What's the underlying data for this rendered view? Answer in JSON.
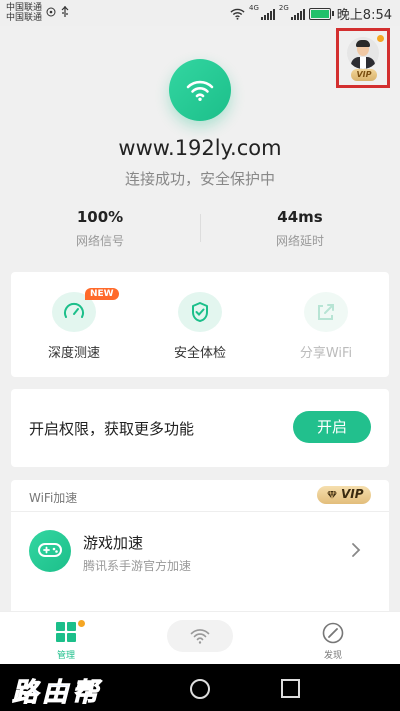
{
  "status_bar": {
    "carrier1": "中国联通",
    "carrier2": "中国联通",
    "net1": "4G",
    "net2": "2G",
    "time": "晚上8:54"
  },
  "profile": {
    "vip_label": "VIP"
  },
  "connection": {
    "ssid": "www.192ly.com",
    "status": "连接成功，安全保护中",
    "signal_value": "100%",
    "signal_label": "网络信号",
    "latency_value": "44ms",
    "latency_label": "网络延时"
  },
  "tools": [
    {
      "label": "深度测速",
      "badge": "NEW",
      "icon": "speedometer-icon"
    },
    {
      "label": "安全体检",
      "icon": "shield-check-icon"
    },
    {
      "label": "分享WiFi",
      "icon": "share-icon",
      "disabled": true
    }
  ],
  "permission": {
    "text": "开启权限，获取更多功能",
    "button": "开启"
  },
  "wifi_accel": {
    "section_title": "WiFi加速",
    "vip_label": "VIP",
    "item_title": "游戏加速",
    "item_subtitle": "腾讯系手游官方加速"
  },
  "tabbar": {
    "tab1": "管理",
    "tab3": "发现"
  },
  "watermark": "路由帮",
  "colors": {
    "accent": "#1cbf8a",
    "badge": "#ff6a2a",
    "highlight_border": "#d32f2f",
    "dot": "#f5a623"
  }
}
